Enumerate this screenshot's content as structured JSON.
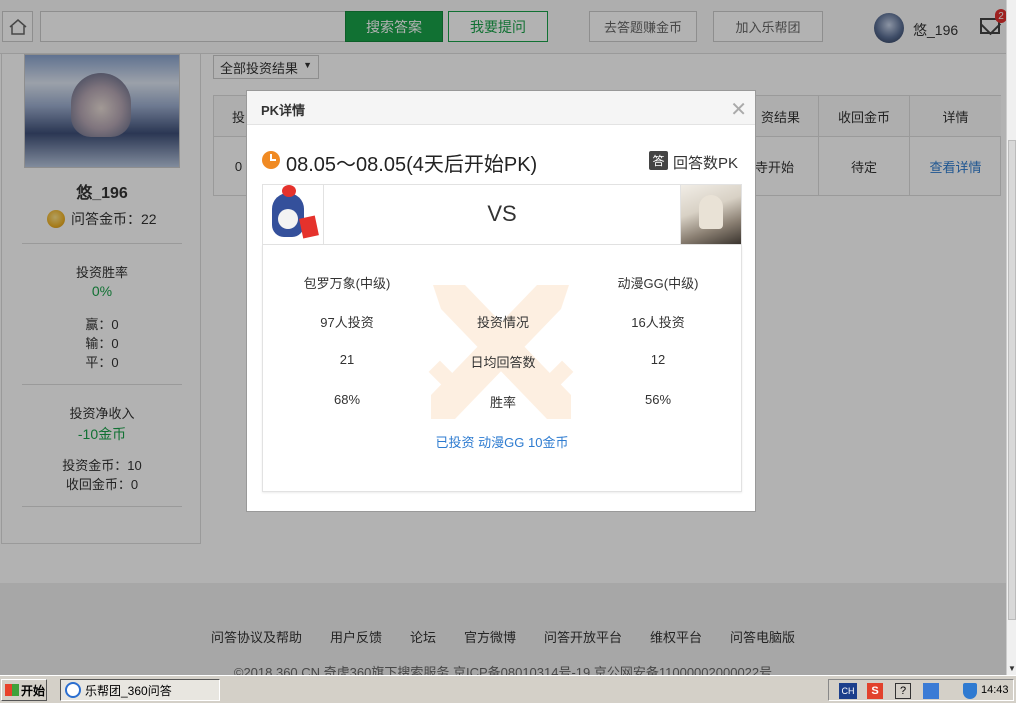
{
  "topbar": {
    "search_button": "搜索答案",
    "ask_button": "我要提问",
    "earn_button": "去答题赚金币",
    "join_button": "加入乐帮团",
    "username": "悠_196",
    "mail_badge": "2"
  },
  "profile": {
    "name": "悠_196",
    "coins_label": "问答金币：22",
    "win_rate_label": "投资胜率",
    "win_rate_value": "0%",
    "wins": "赢：0",
    "losses": "输：0",
    "draws": "平：0",
    "net_income_label": "投资净收入",
    "net_income_value": "-10金币",
    "invested_coins": "投资金币：10",
    "returned_coins": "收回金币：0"
  },
  "filter": {
    "selected": "全部投资结果"
  },
  "table": {
    "headers": [
      "投",
      "资结果",
      "收回金币",
      "详情"
    ],
    "row": [
      "0",
      "寺开始",
      "待定",
      "查看详情"
    ]
  },
  "modal": {
    "title": "PK详情",
    "date": "08.05～08.05(4天后开始PK)",
    "type_icon": "答",
    "type": "回答数PK",
    "vs": "VS",
    "left_name": "包罗万象(中级)",
    "right_name": "动漫GG(中级)",
    "rows": [
      {
        "left": "97人投资",
        "label": "投资情况",
        "right": "16人投资"
      },
      {
        "left": "21",
        "label": "日均回答数",
        "right": "12"
      },
      {
        "left": "68%",
        "label": "胜率",
        "right": "56%"
      }
    ],
    "invested_text": "已投资 动漫GG 10金币"
  },
  "footer": {
    "links": [
      "问答协议及帮助",
      "用户反馈",
      "论坛",
      "官方微博",
      "问答开放平台",
      "维权平台",
      "问答电脑版"
    ],
    "copyright": "©2018 360.CN 奇虎360旗下搜索服务   京ICP备08010314号-19 京公网安备11000002000022号"
  },
  "taskbar": {
    "start": "开始",
    "window_title": "乐帮团_360问答",
    "ime": "CH",
    "time": "14:43"
  },
  "colors": {
    "green": "#19a24a",
    "link": "#2d7bd0",
    "orange": "#f08a23"
  }
}
